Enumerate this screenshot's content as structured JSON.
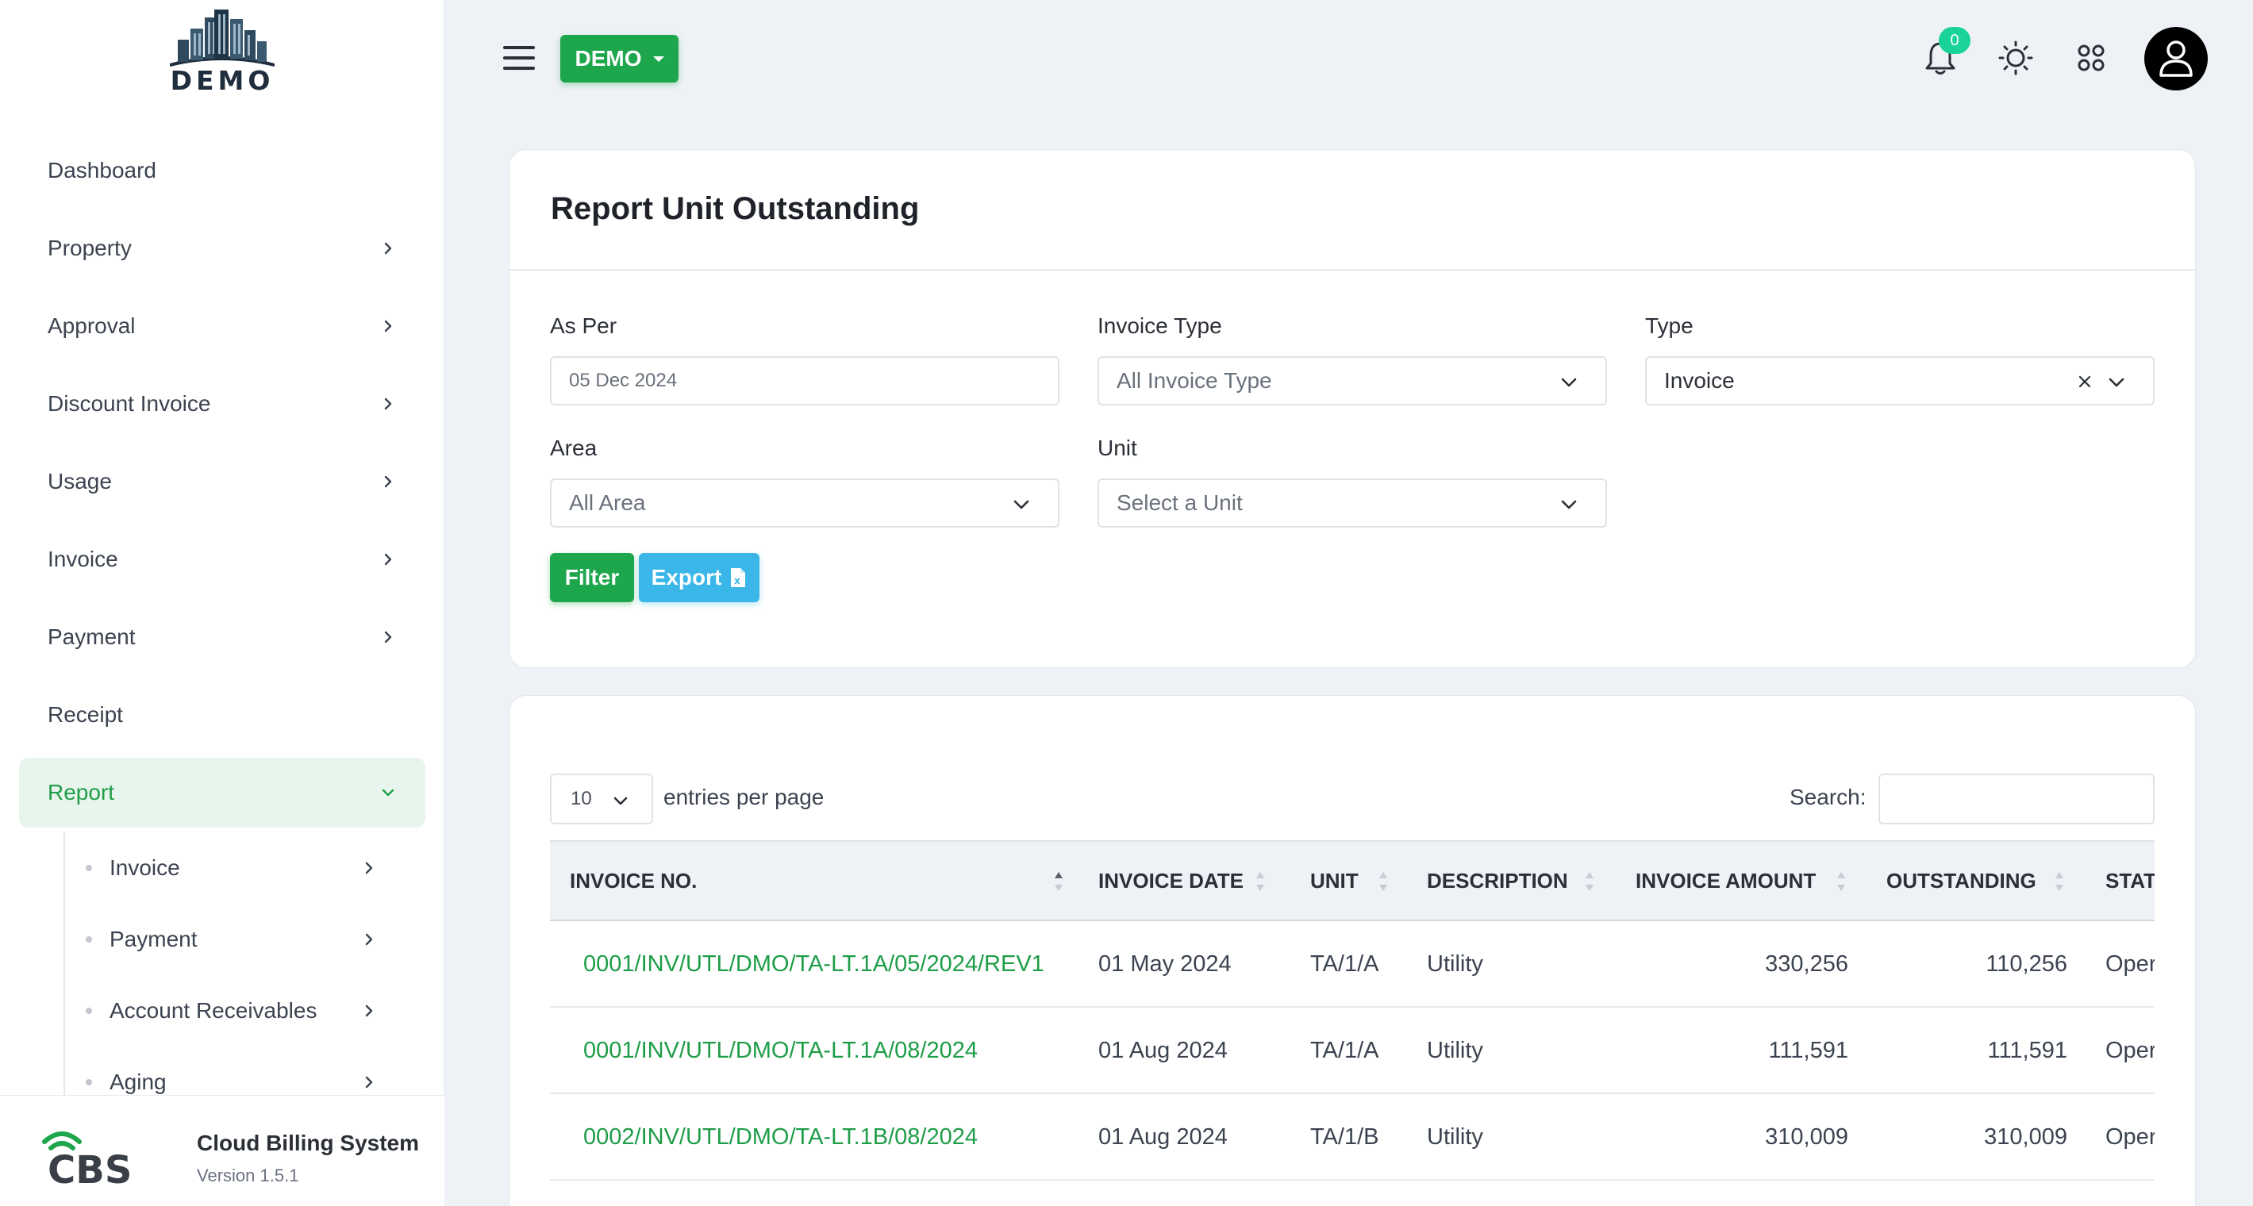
{
  "brand": {
    "logo_text": "DEMO"
  },
  "sidebar": {
    "items": [
      {
        "label": "Dashboard",
        "has_children": false
      },
      {
        "label": "Property",
        "has_children": true
      },
      {
        "label": "Approval",
        "has_children": true
      },
      {
        "label": "Discount Invoice",
        "has_children": true
      },
      {
        "label": "Usage",
        "has_children": true
      },
      {
        "label": "Invoice",
        "has_children": true
      },
      {
        "label": "Payment",
        "has_children": true
      },
      {
        "label": "Receipt",
        "has_children": false
      },
      {
        "label": "Report",
        "has_children": true,
        "active": true,
        "expanded": true
      }
    ],
    "report_subitems": [
      {
        "label": "Invoice"
      },
      {
        "label": "Payment"
      },
      {
        "label": "Account Receivables"
      },
      {
        "label": "Aging"
      }
    ],
    "footer": {
      "title": "Cloud Billing System",
      "version": "Version 1.5.1"
    }
  },
  "topbar": {
    "company_button": "DEMO",
    "notification_count": "0",
    "icons": [
      "menu-icon",
      "bell-icon",
      "sun-icon",
      "apps-grid-icon",
      "user-icon"
    ]
  },
  "filter_card": {
    "title": "Report Unit Outstanding",
    "as_per": {
      "label": "As Per",
      "value": "05 Dec 2024"
    },
    "invoice_type": {
      "label": "Invoice Type",
      "value": "All Invoice Type"
    },
    "type": {
      "label": "Type",
      "value": "Invoice"
    },
    "area": {
      "label": "Area",
      "value": "All Area"
    },
    "unit": {
      "label": "Unit",
      "placeholder": "Select a Unit"
    },
    "filter_button": "Filter",
    "export_button": "Export"
  },
  "table": {
    "page_size": "10",
    "entries_label": "entries per page",
    "search_label": "Search:",
    "search_value": "",
    "columns": [
      "INVOICE NO.",
      "INVOICE DATE",
      "UNIT",
      "DESCRIPTION",
      "INVOICE AMOUNT",
      "OUTSTANDING",
      "STAT"
    ],
    "rows": [
      {
        "invoice_no": "0001/INV/UTL/DMO/TA-LT.1A/05/2024/REV1",
        "date": "01 May 2024",
        "unit": "TA/1/A",
        "description": "Utility",
        "amount": "330,256",
        "outstanding": "110,256",
        "status": "Oper"
      },
      {
        "invoice_no": "0001/INV/UTL/DMO/TA-LT.1A/08/2024",
        "date": "01 Aug 2024",
        "unit": "TA/1/A",
        "description": "Utility",
        "amount": "111,591",
        "outstanding": "111,591",
        "status": "Oper"
      },
      {
        "invoice_no": "0002/INV/UTL/DMO/TA-LT.1B/08/2024",
        "date": "01 Aug 2024",
        "unit": "TA/1/B",
        "description": "Utility",
        "amount": "310,009",
        "outstanding": "310,009",
        "status": "Oper"
      }
    ]
  },
  "colors": {
    "primary": "#1ea64d",
    "info": "#3ab7e8",
    "badge": "#19d39a",
    "link": "#1e9d48"
  }
}
